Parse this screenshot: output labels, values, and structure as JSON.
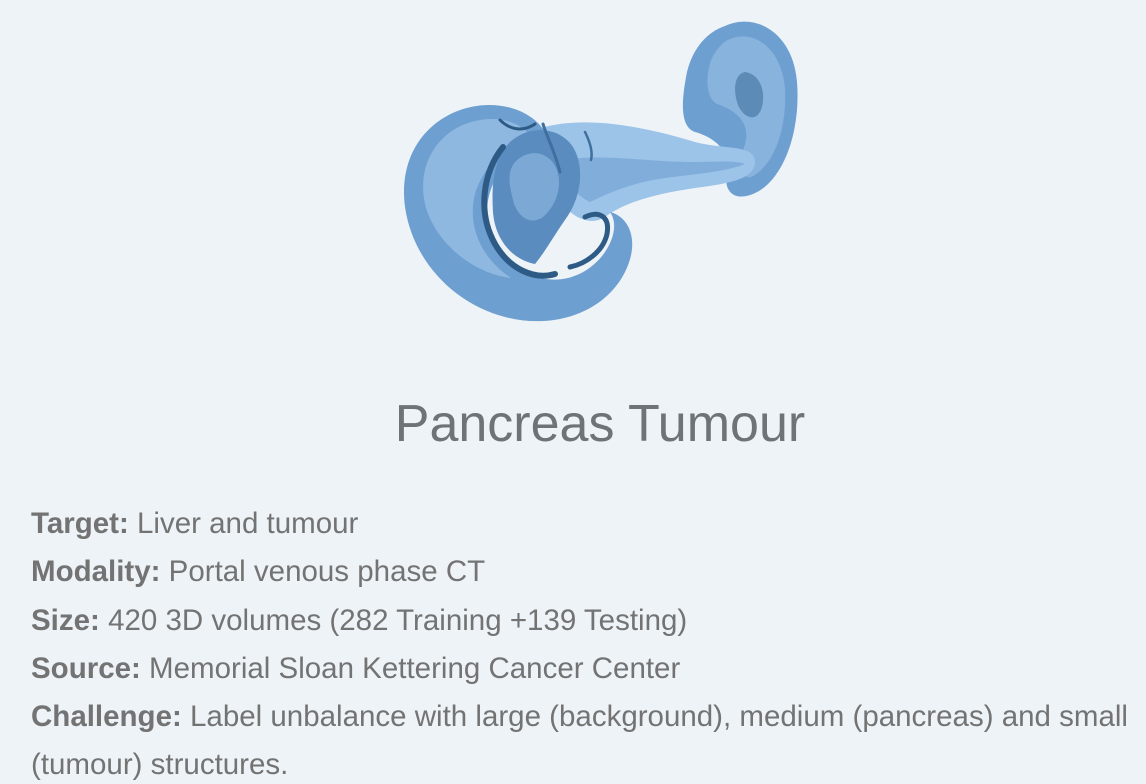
{
  "illustration": {
    "icon": "pancreas-illustration-icon",
    "colors": {
      "light": "#9cc3e8",
      "mid": "#6e9fd1",
      "dark": "#3f6f9e",
      "deep": "#2e5b86"
    }
  },
  "title": "Pancreas Tumour",
  "details": [
    {
      "key": "Target:",
      "value": "Liver and tumour"
    },
    {
      "key": "Modality:",
      "value": "Portal venous phase CT"
    },
    {
      "key": "Size:",
      "value": "420 3D volumes (282 Training +139 Testing)"
    },
    {
      "key": "Source:",
      "value": "Memorial Sloan Kettering Cancer Center"
    },
    {
      "key": "Challenge:",
      "value": "Label unbalance with large (background), medium (pancreas) and small (tumour) structures."
    }
  ]
}
